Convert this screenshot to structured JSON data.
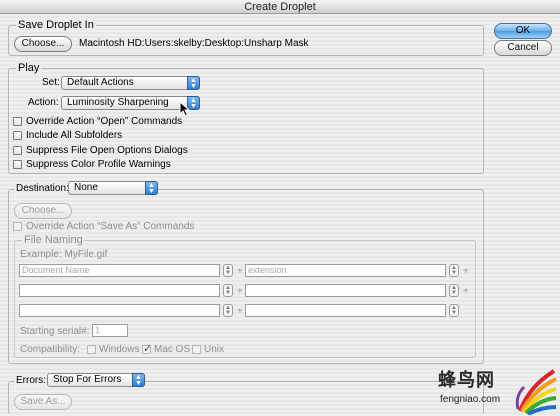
{
  "window": {
    "title": "Create Droplet"
  },
  "buttons": {
    "ok": "OK",
    "cancel": "Cancel"
  },
  "save_droplet": {
    "legend": "Save Droplet In",
    "choose_label": "Choose...",
    "path": "Macintosh HD:Users:skelby:Desktop:Unsharp Mask"
  },
  "play": {
    "legend": "Play",
    "set_label": "Set:",
    "set_value": "Default Actions",
    "action_label": "Action:",
    "action_value": "Luminosity Sharpening",
    "options": [
      {
        "label": "Override Action “Open” Commands",
        "checked": false
      },
      {
        "label": "Include All Subfolders",
        "checked": false
      },
      {
        "label": "Suppress File Open Options Dialogs",
        "checked": false
      },
      {
        "label": "Suppress Color Profile Warnings",
        "checked": false
      }
    ]
  },
  "destination": {
    "label": "Destination:",
    "value": "None",
    "choose_label": "Choose...",
    "override_label": "Override Action “Save As” Commands",
    "file_naming": {
      "legend": "File Naming",
      "example": "Example: MyFile.gif",
      "rows": [
        {
          "left": "Document Name",
          "right": "extension"
        },
        {
          "left": "",
          "right": ""
        },
        {
          "left": "",
          "right": ""
        }
      ],
      "starting_serial_label": "Starting serial#:",
      "starting_serial_value": "1",
      "compatibility_label": "Compatibility:",
      "compat": [
        {
          "label": "Windows",
          "checked": false
        },
        {
          "label": "Mac OS",
          "checked": true
        },
        {
          "label": "Unix",
          "checked": false
        }
      ]
    }
  },
  "errors": {
    "label": "Errors:",
    "value": "Stop For Errors",
    "save_as_label": "Save As..."
  },
  "watermark": {
    "cn": "蜂鸟网",
    "url": "fengniao.com"
  }
}
